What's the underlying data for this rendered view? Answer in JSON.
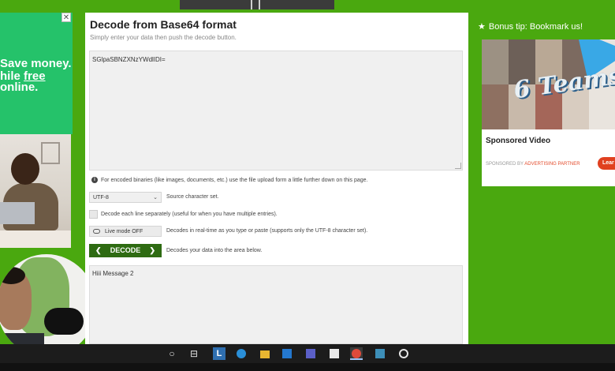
{
  "topstrip": {},
  "left_ad": {
    "close_label": "✕",
    "line1": "Save money.",
    "line2_prefix": "hile ",
    "line2_emph": "free",
    "line3": "online."
  },
  "main": {
    "title": "Decode from Base64 format",
    "subtitle": "Simply enter your data then push the decode button.",
    "input_value": "SGlpaSBNZXNzYWdlIDI=",
    "note_icon": "i",
    "note": "For encoded binaries (like images, documents, etc.) use the file upload form a little further down on this page.",
    "charset_value": "UTF-8",
    "charset_label": "Source character set.",
    "each_line_label": "Decode each line separately (useful for when you have multiple entries).",
    "live_mode_label": "Live mode OFF",
    "live_mode_desc": "Decodes in real-time as you type or paste (supports only the UTF-8 character set).",
    "decode_label": "DECODE",
    "decode_desc": "Decodes your data into the area below.",
    "output_value": "Hiii Message 2"
  },
  "sidebar": {
    "bonus_tip": "Bonus tip: Bookmark us!",
    "ad_logo": "6 Teams",
    "ad_title": "Sponsored Video",
    "ad_by_prefix": "SPONSORED BY ",
    "ad_by_partner": "ADVERTISING PARTNER",
    "ad_button": "Lear"
  },
  "taskbar": {
    "items": [
      {
        "icon": "search-icon",
        "glyph": "○"
      },
      {
        "icon": "task-view-icon",
        "glyph": "⊟"
      },
      {
        "icon": "app-l-icon",
        "glyph": "L"
      },
      {
        "icon": "edge-icon",
        "glyph": ""
      },
      {
        "icon": "file-explorer-icon",
        "glyph": ""
      },
      {
        "icon": "mail-icon",
        "glyph": ""
      },
      {
        "icon": "teams-icon",
        "glyph": ""
      },
      {
        "icon": "notepad-icon",
        "glyph": ""
      },
      {
        "icon": "chrome-icon",
        "glyph": ""
      },
      {
        "icon": "app-icon",
        "glyph": ""
      },
      {
        "icon": "app-circle-icon",
        "glyph": ""
      }
    ]
  },
  "colors": {
    "page_bg": "#4aa80f",
    "decode_button": "#2e6b12",
    "learn_button": "#e0401f"
  }
}
